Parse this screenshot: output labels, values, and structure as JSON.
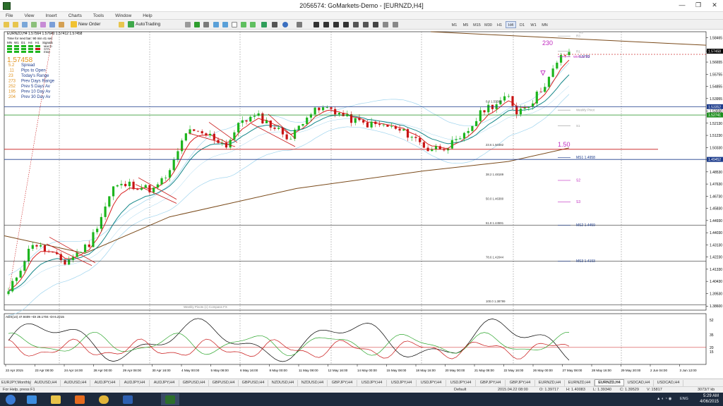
{
  "window": {
    "title": "2056574: GoMarkets-Demo - [EURNZD,H4]",
    "minimize": "—",
    "maximize": "❐",
    "close": "✕"
  },
  "menu": [
    "File",
    "View",
    "Insert",
    "Charts",
    "Tools",
    "Window",
    "Help"
  ],
  "toolbar": {
    "new_order": "New Order",
    "autotrading": "AutoTrading",
    "timeframes": [
      "M1",
      "M5",
      "M15",
      "M30",
      "H1",
      "H4",
      "D1",
      "W1",
      "MN"
    ],
    "active_timeframe": "H4"
  },
  "chart": {
    "header": "EURNZD,H4  1.57564 1.57640 1.57412 1.57458",
    "bars_timer": "Time for next bar: 90 min 41 sec",
    "signal_tf_labels": [
      "MN",
      "W1",
      "D1",
      "H4",
      "H1",
      "Signals"
    ],
    "signal_names": [
      "MACD",
      "STR",
      "EMA"
    ],
    "info_price": "1.57458",
    "info_rows": [
      {
        "value": "5.2",
        "label": "Spread"
      },
      {
        "value": ".11",
        "label": "Pips to Open"
      },
      {
        "value": "23",
        "label": "Today's Range"
      },
      {
        "value": "273",
        "label": "Prev Days Range"
      },
      {
        "value": "252",
        "label": "Prev 5 Days Av"
      },
      {
        "value": "195",
        "label": "Prev 10 Day Av"
      },
      {
        "value": "204",
        "label": "Prev 30 Day Av"
      }
    ],
    "price_ticks": [
      "1.58465",
      "1.57458",
      "1.56655",
      "1.55755",
      "1.54855",
      "1.53955",
      "1.53030",
      "1.52130",
      "1.51230",
      "1.50330",
      "1.49452",
      "1.48530",
      "1.47630",
      "1.46730",
      "1.45830",
      "1.44930",
      "1.44030",
      "1.43130",
      "1.42230",
      "1.41330",
      "1.40430",
      "1.39530",
      "1.38600"
    ],
    "highlighted_prices": [
      {
        "value": "1.57458",
        "color": "#000000"
      },
      {
        "value": "1.53352",
        "color": "#1d3c8c"
      },
      {
        "value": "1.52741",
        "color": "#1e8f1e"
      },
      {
        "value": "1.49452",
        "color": "#1d3c8c"
      }
    ],
    "time_ticks": [
      "22 Apr 2015",
      "23 Apr 08:00",
      "24 Apr 16:00",
      "28 Apr 00:00",
      "29 Apr 08:00",
      "30 Apr 16:00",
      "4 May 00:00",
      "5 May 08:00",
      "6 May 16:00",
      "8 May 00:00",
      "11 May 08:00",
      "12 May 16:00",
      "14 May 00:00",
      "15 May 08:00",
      "18 May 16:00",
      "20 May 00:00",
      "21 May 08:00",
      "22 May 16:00",
      "26 May 00:00",
      "27 May 08:00",
      "28 May 16:00",
      "29 May 20:00",
      "2 Jun 04:00",
      "3 Jun 12:00"
    ],
    "fib_labels": [
      "0.0  1.53568",
      "23.6  1.50382",
      "38.2  1.48189",
      "50.0  1.46380",
      "61.8  1.44591",
      "78.6  1.42044",
      "100.0  1.38799"
    ],
    "pivot_labels": [
      "R3",
      "R1",
      "WkPivot R2",
      "Weekly Pivot",
      "S1",
      "MS1  1.4958",
      "S2",
      "S3",
      "MS2  1.4459",
      "MS3  1.4193"
    ],
    "pivot_top_label": "R3",
    "pivot_r1_value": "1.5723",
    "annotation_230": "230",
    "annotation_150": "1.50",
    "weekly_pivots_credit": "Weekly Pivots (c) Compass FX",
    "adx_header": "ADX(14) 47.9409  +DI 28.1704  -DI 6.2215",
    "adx_ticks": [
      "52",
      "35",
      "20",
      "15"
    ],
    "colors": {
      "up_candle": "#1db51d",
      "down_candle": "#c81414",
      "ema_fast": "#d81e1e",
      "ema_slow": "#16888a",
      "sma_long": "#7a4a1a",
      "bollinger": "#9fd4ee",
      "pivot_blue": "#1d3c8c",
      "pivot_green": "#1e8f1e",
      "annotation_magenta": "#c02cc0",
      "adx_line": "#000000",
      "plus_di": "#2aa52a",
      "minus_di": "#c81414"
    }
  },
  "tabs": [
    "EURJPY,Monthly",
    "AUDUSD,H4",
    "AUDUSD,H4",
    "AUDJPY,H4",
    "AUDJPY,H4",
    "AUDJPY,H4",
    "GBPUSD,H4",
    "GBPUSD,H4",
    "GBPUSD,H4",
    "NZDUSD,H4",
    "NZDUSD,H4",
    "GBPJPY,H4",
    "USDJPY,H4",
    "USDJPY,H4",
    "USDJPY,H4",
    "USDJPY,H4",
    "GBPJPY,H4",
    "GBPJPY,H4",
    "EURNZD,H4",
    "EURNZD,H4",
    "EURNZD,H4",
    "USDCAD,H4",
    "USDCAD,H4"
  ],
  "active_tab": 20,
  "status": {
    "help": "For Help, press F1",
    "profile": "Default",
    "datetime": "2015.04.22 08:00",
    "open": "O: 1.39717",
    "high": "H: 1.40083",
    "low": "L: 1.39340",
    "close": "C: 1.39529",
    "volume": "V: 15817",
    "traffic": "3073/7 kb"
  },
  "taskbar": {
    "lang": "ENG",
    "time": "5:29 AM",
    "date": "4/06/2015",
    "apps": [
      "ie-app",
      "explorer-app",
      "chrome-app",
      "media-app",
      "word-app",
      "terminal-app"
    ]
  }
}
